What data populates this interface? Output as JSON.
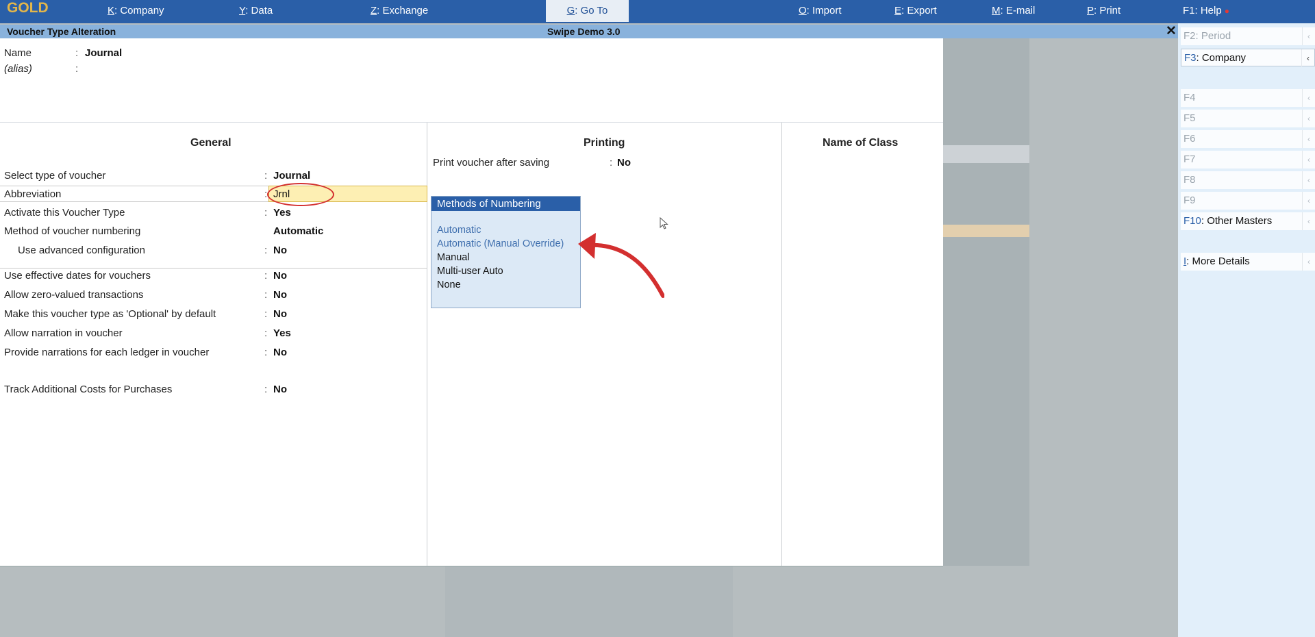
{
  "topbar": {
    "brand": "GOLD",
    "menu": [
      {
        "key": "K",
        "label": ": Company"
      },
      {
        "key": "Y",
        "label": ": Data"
      },
      {
        "key": "Z",
        "label": ": Exchange"
      },
      {
        "key": "O",
        "label": ": Import"
      },
      {
        "key": "E",
        "label": ": Export"
      },
      {
        "key": "M",
        "label": ": E-mail"
      },
      {
        "key": "P",
        "label": ": Print"
      }
    ],
    "goto": {
      "key": "G",
      "label": ": Go To"
    },
    "help": "F1: Help"
  },
  "titlebar": {
    "left": "Voucher Type Alteration",
    "center": "Swipe Demo 3.0",
    "close": "✕"
  },
  "name_block": {
    "name_label": "Name",
    "name_value": "Journal",
    "alias_label": "(alias)",
    "colon": ":"
  },
  "general": {
    "heading": "General",
    "rows": [
      {
        "label": "Select type of voucher",
        "value": "Journal"
      },
      {
        "label": "Abbreviation",
        "value": "Jrnl"
      },
      {
        "label": "Activate this Voucher Type",
        "value": "Yes"
      },
      {
        "label": "Method of voucher numbering",
        "value": "Automatic"
      },
      {
        "label": "Use advanced configuration",
        "value": "No"
      },
      {
        "label": "Use effective dates for vouchers",
        "value": "No"
      },
      {
        "label": "Allow zero-valued transactions",
        "value": "No"
      },
      {
        "label": "Make this voucher type as 'Optional' by default",
        "value": "No"
      },
      {
        "label": "Allow narration in voucher",
        "value": "Yes"
      },
      {
        "label": "Provide narrations for each ledger in voucher",
        "value": "No"
      },
      {
        "label": "Track Additional Costs for Purchases",
        "value": "No"
      }
    ]
  },
  "printing": {
    "heading": "Printing",
    "row_label": "Print voucher after saving",
    "row_value": "No"
  },
  "name_of_class": {
    "heading": "Name of Class"
  },
  "popup": {
    "title": "Methods of Numbering",
    "options": [
      "Automatic",
      "Automatic (Manual Override)",
      "Manual",
      "Multi-user Auto",
      "None"
    ]
  },
  "sidebar": {
    "items": [
      {
        "key": "F2",
        "label": ": Period"
      },
      {
        "key": "F3",
        "label": ": Company"
      },
      {
        "key": "F4",
        "label": ""
      },
      {
        "key": "F5",
        "label": ""
      },
      {
        "key": "F6",
        "label": ""
      },
      {
        "key": "F7",
        "label": ""
      },
      {
        "key": "F8",
        "label": ""
      },
      {
        "key": "F9",
        "label": ""
      },
      {
        "key": "F10",
        "label": ": Other Masters"
      },
      {
        "key": "I",
        "label": ": More Details"
      }
    ],
    "chevron": "‹"
  },
  "colors": {
    "topbar": "#2a5fa8",
    "titlebar": "#89b2dc",
    "highlight": "#fdefb3",
    "annotation_red": "#d32f2f",
    "sidebar_bg": "#e2effa"
  }
}
